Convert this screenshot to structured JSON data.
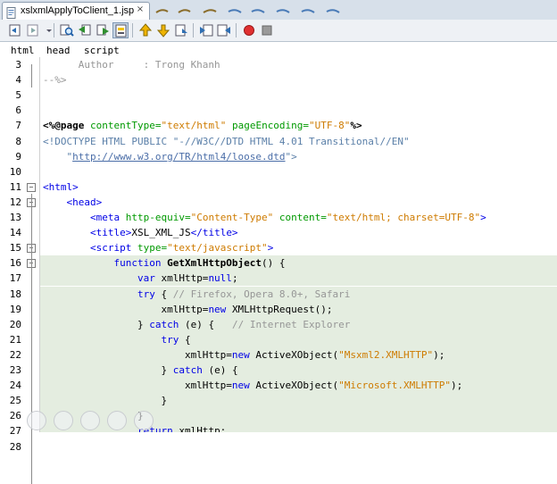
{
  "tab": {
    "filename": "xslxmlApplyToClient_1.jsp",
    "close_glyph": "×"
  },
  "breadcrumbs": [
    "html",
    "head",
    "script"
  ],
  "toolbar_icons": [
    "history-back-icon",
    "history-forward-icon",
    "find-icon",
    "find-previous-icon",
    "find-next-icon",
    "toggle-highlight-icon",
    "previous-bookmark-icon",
    "next-bookmark-icon",
    "toggle-bookmark-icon",
    "shift-left-icon",
    "shift-right-icon",
    "start-macro-icon",
    "stop-macro-icon"
  ],
  "lines": [
    {
      "n": "3",
      "segs": [
        [
          "cmt",
          "      Author     : Trong Khanh"
        ]
      ]
    },
    {
      "n": "4",
      "segs": [
        [
          "cmt",
          "--%>"
        ]
      ]
    },
    {
      "n": "5",
      "segs": []
    },
    {
      "n": "6",
      "segs": []
    },
    {
      "n": "7",
      "segs": [
        [
          "jsp",
          "<%@page "
        ],
        [
          "attr",
          "contentType="
        ],
        [
          "str",
          "\"text/html\""
        ],
        [
          "plain",
          " "
        ],
        [
          "attr",
          "pageEncoding="
        ],
        [
          "str",
          "\"UTF-8\""
        ],
        [
          "jsp",
          "%>"
        ]
      ]
    },
    {
      "n": "8",
      "segs": [
        [
          "doctype",
          "<!DOCTYPE HTML PUBLIC \"-//W3C//DTD HTML 4.01 Transitional//EN\""
        ]
      ]
    },
    {
      "n": "9",
      "segs": [
        [
          "doctype",
          "    \""
        ],
        [
          "link",
          "http://www.w3.org/TR/html4/loose.dtd"
        ],
        [
          "doctype",
          "\">"
        ]
      ]
    },
    {
      "n": "10",
      "segs": []
    },
    {
      "n": "11",
      "segs": [
        [
          "tag",
          "<html>"
        ]
      ]
    },
    {
      "n": "12",
      "segs": [
        [
          "tag",
          "    <head>"
        ]
      ]
    },
    {
      "n": "13",
      "segs": [
        [
          "tag",
          "        <meta "
        ],
        [
          "attr",
          "http-equiv="
        ],
        [
          "str",
          "\"Content-Type\""
        ],
        [
          "plain",
          " "
        ],
        [
          "attr",
          "content="
        ],
        [
          "str",
          "\"text/html; charset=UTF-8\""
        ],
        [
          "tag",
          ">"
        ]
      ]
    },
    {
      "n": "14",
      "segs": [
        [
          "tag",
          "        <title>"
        ],
        [
          "plain",
          "XSL_XML_JS"
        ],
        [
          "tag",
          "</title>"
        ]
      ]
    },
    {
      "n": "15",
      "segs": [
        [
          "tag",
          "        <script "
        ],
        [
          "attr",
          "type="
        ],
        [
          "str",
          "\"text/javascript\""
        ],
        [
          "tag",
          ">"
        ]
      ]
    },
    {
      "n": "16",
      "segs": [
        [
          "kw",
          "            function "
        ],
        [
          "bold",
          "GetXmlHttpObject"
        ],
        [
          "plain",
          "() {"
        ]
      ]
    },
    {
      "n": "17",
      "segs": [
        [
          "kw",
          "                var "
        ],
        [
          "plain",
          "xmlHttp="
        ],
        [
          "kw",
          "null"
        ],
        [
          "plain",
          ";"
        ]
      ]
    },
    {
      "n": "18",
      "segs": [
        [
          "kw",
          "                try "
        ],
        [
          "plain",
          "{ "
        ],
        [
          "cmt",
          "// Firefox, Opera 8.0+, Safari"
        ]
      ]
    },
    {
      "n": "19",
      "segs": [
        [
          "plain",
          "                    xmlHttp="
        ],
        [
          "kw",
          "new "
        ],
        [
          "plain",
          "XMLHttpRequest();"
        ]
      ]
    },
    {
      "n": "20",
      "segs": [
        [
          "plain",
          "                } "
        ],
        [
          "kw",
          "catch "
        ],
        [
          "plain",
          "(e) {   "
        ],
        [
          "cmt",
          "// Internet Explorer"
        ]
      ]
    },
    {
      "n": "21",
      "segs": [
        [
          "kw",
          "                    try "
        ],
        [
          "plain",
          "{"
        ]
      ]
    },
    {
      "n": "22",
      "segs": [
        [
          "plain",
          "                        xmlHttp="
        ],
        [
          "kw",
          "new "
        ],
        [
          "plain",
          "ActiveXObject("
        ],
        [
          "str",
          "\"Msxml2.XMLHTTP\""
        ],
        [
          "plain",
          ");"
        ]
      ]
    },
    {
      "n": "23",
      "segs": [
        [
          "plain",
          "                    } "
        ],
        [
          "kw",
          "catch "
        ],
        [
          "plain",
          "(e) {"
        ]
      ]
    },
    {
      "n": "24",
      "segs": [
        [
          "plain",
          "                        xmlHttp="
        ],
        [
          "kw",
          "new "
        ],
        [
          "plain",
          "ActiveXObject("
        ],
        [
          "str",
          "\"Microsoft.XMLHTTP\""
        ],
        [
          "plain",
          ");"
        ]
      ]
    },
    {
      "n": "25",
      "segs": [
        [
          "plain",
          "                    }"
        ]
      ]
    },
    {
      "n": "26",
      "segs": [
        [
          "plain",
          "                }"
        ]
      ]
    },
    {
      "n": "27",
      "segs": [
        [
          "kw",
          "                return "
        ],
        [
          "plain",
          "xmlHttp;"
        ]
      ]
    },
    {
      "n": "28",
      "segs": [
        [
          "plain",
          "            }"
        ]
      ]
    }
  ],
  "colors": {
    "highlight_bg": "#e4ede0",
    "keyword": "#0000e6",
    "string": "#ce7b00",
    "attribute": "#009900",
    "comment": "#969696"
  }
}
